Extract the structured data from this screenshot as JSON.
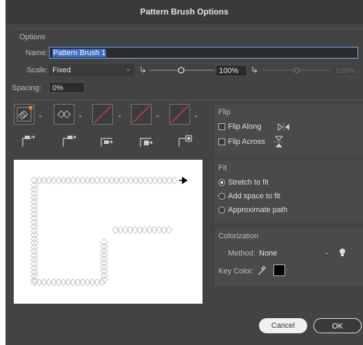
{
  "dialog": {
    "title": "Pattern Brush Options"
  },
  "options": {
    "header": "Options",
    "name_label": "Name:",
    "name_value": "Pattern Brush 1",
    "scale_label": "Scale:",
    "scale_value": "Fixed",
    "scale_percent": "100%",
    "scale_percent_disabled": "100%",
    "spacing_label": "Spacing:",
    "spacing_value": "0%"
  },
  "flip": {
    "header": "Flip",
    "flip_along": "Flip Along",
    "flip_across": "Flip Across"
  },
  "fit": {
    "header": "Fit",
    "stretch": "Stretch to fit",
    "add_space": "Add space to fit",
    "approximate": "Approximate path"
  },
  "colorization": {
    "header": "Colorization",
    "method_label": "Method:",
    "method_value": "None",
    "key_color_label": "Key Color:",
    "key_color": "#000000"
  },
  "buttons": {
    "cancel": "Cancel",
    "ok": "OK"
  },
  "colors": {
    "accent": "#3a6fc8",
    "tile_slash": "#d04040",
    "tile_accent": "#e08a30"
  }
}
